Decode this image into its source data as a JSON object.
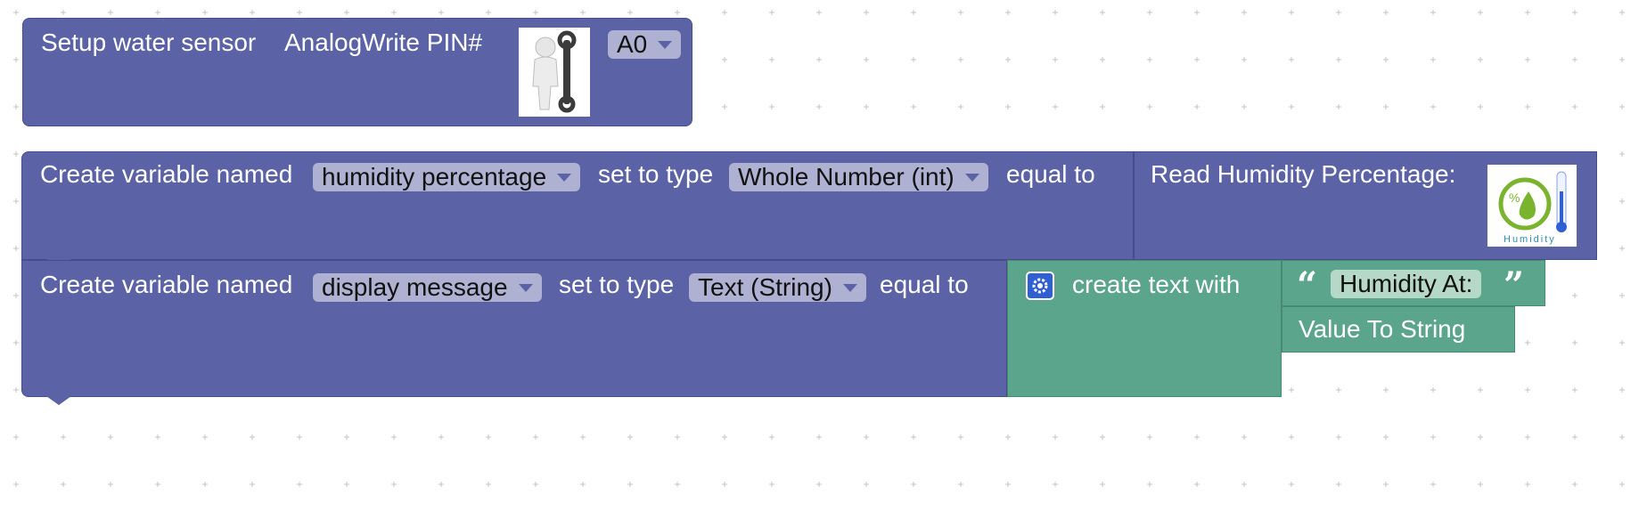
{
  "blocks": {
    "setup": {
      "label": "Setup water sensor",
      "pin_label": "AnalogWrite PIN#",
      "pin_value": "A0",
      "image_icon": "wrench-figure-icon"
    },
    "var1": {
      "prefix": "Create variable named",
      "name_value": "humidity percentage",
      "type_label": "set to type",
      "type_value": "Whole Number (int)",
      "equal_label": "equal to",
      "read_label": "Read Humidity Percentage:",
      "image_icon": "humidity-icon",
      "image_caption": "Humidity"
    },
    "var2": {
      "prefix": "Create variable named",
      "name_value": "display message",
      "type_label": "set to type",
      "type_value": "Text (String)",
      "equal_label": "equal to",
      "create_text_label": "create text with",
      "string_value": "Humidity At:",
      "value_to_string_label": "Value To String"
    }
  },
  "colors": {
    "purple_block": "#5b63a6",
    "green_block": "#5ba58c",
    "dropdown": "#aeb1d2",
    "background": "#ffffff"
  }
}
